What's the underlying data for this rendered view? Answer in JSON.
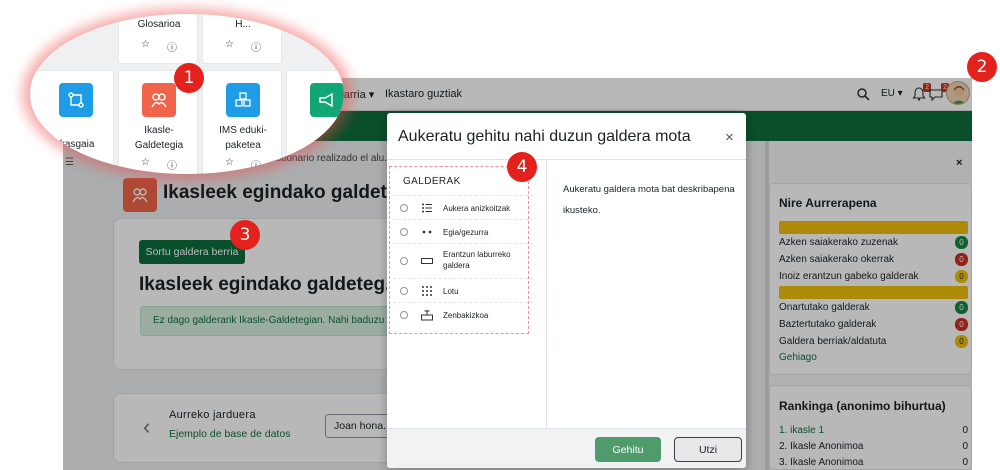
{
  "navbar": {
    "links": [
      "...lgarria ▾",
      "Ikastaro guztiak"
    ],
    "language": "EU ▾",
    "notifications_count": "2",
    "messages_count": "2"
  },
  "course": {
    "breadcrumb": "Cuestionario realizado el alu...",
    "page_heading": "Ikasleek egindako galdet...",
    "create_button": "Sortu galdera berria",
    "card_heading": "Ikasleek egindako galdeteg...",
    "info_alert": "Ez dago galderarik Ikasle-Galdetegian. Nahi baduzu gal...",
    "prev_activity_label": "Aurreko jarduera",
    "prev_activity_link": "Ejemplo de base de datos",
    "jump_select": "Joan hona..."
  },
  "modal": {
    "title": "Aukeratu gehitu nahi duzun galdera mota",
    "close_label": "×",
    "list_title": "GALDERAK",
    "options": [
      {
        "label": "Aukera anizkoitzak",
        "icon": "list-icon"
      },
      {
        "label": "Egia/gezurra",
        "icon": "dots-icon"
      },
      {
        "label": "Erantzun laburreko galdera",
        "icon": "short-answer-icon"
      },
      {
        "label": "Lotu",
        "icon": "grid-dots-icon"
      },
      {
        "label": "Zenbakizkoa",
        "icon": "numeric-icon"
      }
    ],
    "description": "Aukeratu galdera mota bat deskribapena ikusteko.",
    "add_button": "Gehitu",
    "cancel_button": "Utzi"
  },
  "drawer": {
    "close_label": "×",
    "progress_title": "Nire Aurrerapena",
    "stats_group1": [
      {
        "label": "Azken saiakerako zuzenak",
        "value": "0",
        "color": "green"
      },
      {
        "label": "Azken saiakerako okerrak",
        "value": "0",
        "color": "red"
      },
      {
        "label": "Inoiz erantzun gabeko galderak",
        "value": "0",
        "color": "yellow"
      }
    ],
    "stats_group2": [
      {
        "label": "Onartutako galderak",
        "value": "0",
        "color": "green"
      },
      {
        "label": "Baztertutako galderak",
        "value": "0",
        "color": "red"
      },
      {
        "label": "Galdera berriak/aldatuta",
        "value": "0",
        "color": "yellow"
      }
    ],
    "more_link": "Gehiago",
    "ranking_title": "Rankinga (anonimo bihurtua)",
    "ranking": [
      {
        "label": "1. ikasle 1",
        "value": "0"
      },
      {
        "label": "2. Ikasle Anonimoa",
        "value": "0"
      },
      {
        "label": "3. Ikasle Anonimoa",
        "value": "0"
      }
    ]
  },
  "zoom": {
    "top_labels": [
      "Glosarioa",
      "H..."
    ],
    "tiles": [
      {
        "label": "...kasgaia",
        "icon": "lesson-icon",
        "color": "#1e9ce5"
      },
      {
        "label": "Ikasle-\nGaldetegia",
        "icon": "student-quiz-icon",
        "color": "#f0644a"
      },
      {
        "label": "IMS eduki-\npaketea",
        "icon": "ims-package-icon",
        "color": "#1e9ce5"
      },
      {
        "label": "",
        "icon": "megaphone-icon",
        "color": "#12a575"
      }
    ]
  },
  "markers": [
    "1",
    "2",
    "3",
    "4"
  ],
  "colors": {
    "brand_green": "#0f6e3d",
    "marker_red": "#e3211d",
    "activity_orange": "#f0644a",
    "activity_blue": "#1e9ce5"
  }
}
